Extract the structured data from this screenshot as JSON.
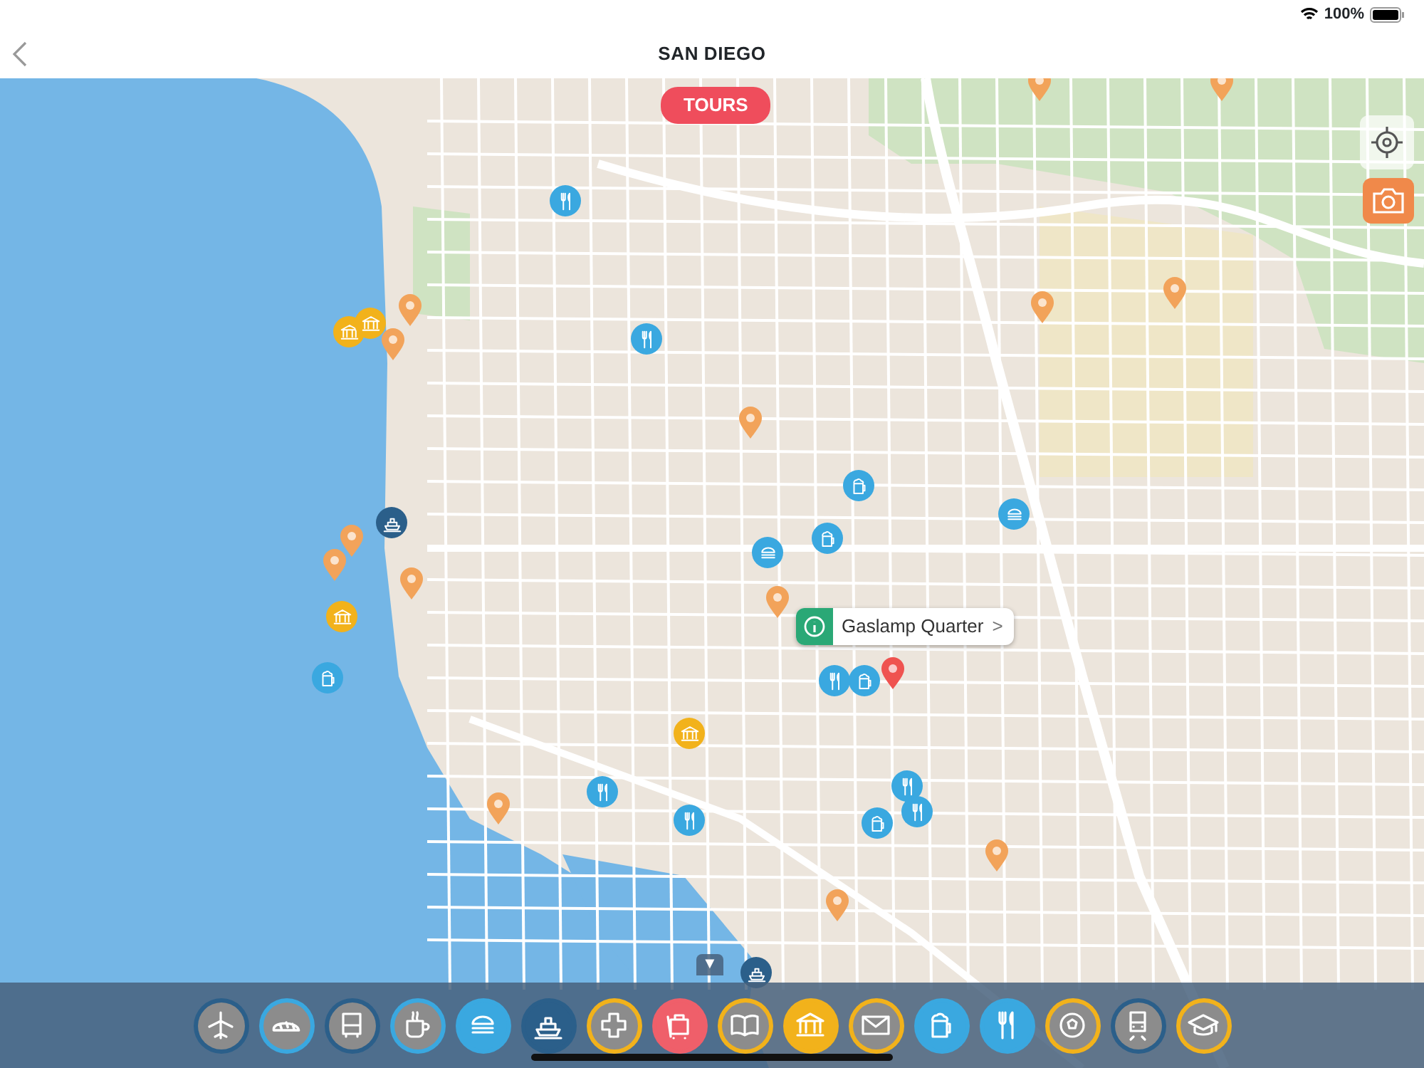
{
  "status_bar": {
    "battery": "100%"
  },
  "header": {
    "title": "SAN DIEGO"
  },
  "tours_button": {
    "label": "TOURS"
  },
  "markers": [
    {
      "kind": "fork",
      "color": "#3aa8e0"
    },
    {
      "kind": "fork",
      "color": "#3aa8e0"
    },
    {
      "kind": "fork",
      "color": "#3aa8e0"
    },
    {
      "kind": "fork",
      "color": "#3aa8e0"
    },
    {
      "kind": "fork",
      "color": "#3aa8e0"
    },
    {
      "kind": "fork",
      "color": "#3aa8e0"
    },
    {
      "kind": "fork",
      "color": "#3aa8e0"
    },
    {
      "kind": "beer",
      "color": "#3aa8e0"
    },
    {
      "kind": "beer",
      "color": "#3aa8e0"
    },
    {
      "kind": "beer",
      "color": "#3aa8e0"
    },
    {
      "kind": "beer",
      "color": "#3aa8e0"
    },
    {
      "kind": "beer",
      "color": "#3aa8e0"
    },
    {
      "kind": "burger",
      "color": "#3aa8e0"
    },
    {
      "kind": "burger",
      "color": "#3aa8e0"
    },
    {
      "kind": "ship",
      "color": "#2b5f8a"
    },
    {
      "kind": "ship",
      "color": "#2b5f8a"
    },
    {
      "kind": "museum",
      "color": "#f2b21b"
    },
    {
      "kind": "museum",
      "color": "#f2b21b"
    },
    {
      "kind": "museum",
      "color": "#f2b21b"
    },
    {
      "kind": "museum",
      "color": "#f2b21b"
    },
    {
      "kind": "pin",
      "color": "#f2a35a"
    },
    {
      "kind": "pin",
      "color": "#f2a35a"
    },
    {
      "kind": "pin",
      "color": "#f2a35a"
    },
    {
      "kind": "pin",
      "color": "#f2a35a"
    },
    {
      "kind": "pin",
      "color": "#f2a35a"
    },
    {
      "kind": "pin",
      "color": "#f2a35a"
    },
    {
      "kind": "pin",
      "color": "#f2a35a"
    },
    {
      "kind": "pin",
      "color": "#f2a35a"
    },
    {
      "kind": "pin",
      "color": "#f2a35a"
    },
    {
      "kind": "pin",
      "color": "#f2a35a"
    },
    {
      "kind": "pin",
      "color": "#f2a35a"
    },
    {
      "kind": "pin",
      "color": "#f2a35a"
    },
    {
      "kind": "pin",
      "color": "#f2a35a"
    },
    {
      "kind": "pin",
      "color": "#f2a35a"
    },
    {
      "kind": "pin",
      "color": "#ef5350"
    }
  ],
  "callout": {
    "label": "Gaslamp Quarter",
    "chevron": ">"
  },
  "drawer_handle": "▼",
  "categories": [
    {
      "kind": "plane",
      "color": "#8c8c8c",
      "ring": {
        "color": "#2b5f8a"
      }
    },
    {
      "kind": "bread",
      "color": "#8c8c8c",
      "ring": {
        "color": "#3aa8e0"
      }
    },
    {
      "kind": "bus",
      "color": "#8c8c8c",
      "ring": {
        "color": "#2b5f8a"
      }
    },
    {
      "kind": "coffee",
      "color": "#8c8c8c",
      "ring": {
        "color": "#3aa8e0"
      }
    },
    {
      "kind": "burger",
      "color": "#3aa8e0",
      "ring": {
        "color": "#3aa8e0"
      }
    },
    {
      "kind": "ship",
      "color": "#2b5f8a",
      "ring": {
        "color": "#2b5f8a"
      }
    },
    {
      "kind": "cross",
      "color": "#8c8c8c",
      "ring": {
        "color": "#f2b21b"
      }
    },
    {
      "kind": "luggage",
      "color": "#ef5f6a",
      "ring": {
        "color": "#ef5f6a"
      }
    },
    {
      "kind": "book",
      "color": "#8c8c8c",
      "ring": {
        "color": "#f2b21b"
      }
    },
    {
      "kind": "museum",
      "color": "#f2b21b",
      "ring": {
        "color": "#f2b21b"
      }
    },
    {
      "kind": "mail",
      "color": "#8c8c8c",
      "ring": {
        "color": "#f2b21b"
      }
    },
    {
      "kind": "beer",
      "color": "#3aa8e0",
      "ring": {
        "color": "#3aa8e0"
      }
    },
    {
      "kind": "fork",
      "color": "#3aa8e0",
      "ring": {
        "color": "#3aa8e0"
      }
    },
    {
      "kind": "ball",
      "color": "#8c8c8c",
      "ring": {
        "color": "#f2b21b"
      }
    },
    {
      "kind": "train",
      "color": "#8c8c8c",
      "ring": {
        "color": "#2b5f8a"
      }
    },
    {
      "kind": "cap",
      "color": "#8c8c8c",
      "ring": {
        "color": "#f2b21b"
      }
    }
  ]
}
